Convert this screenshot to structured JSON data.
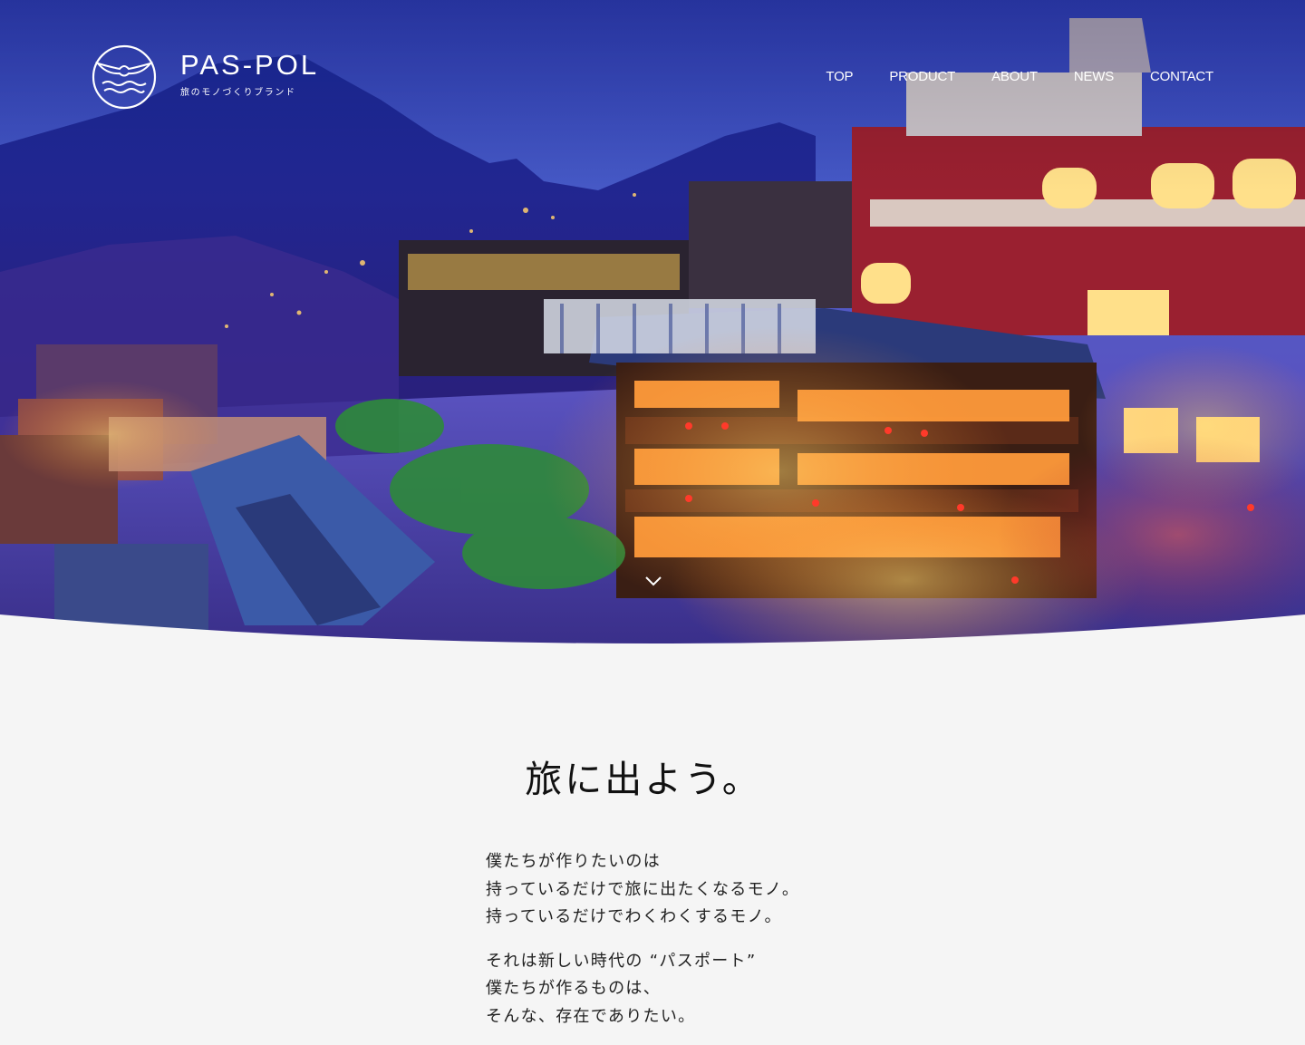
{
  "brand": {
    "name": "PAS-POL",
    "tagline": "旅のモノづくりブランド"
  },
  "nav": {
    "items": [
      "TOP",
      "PRODUCT",
      "ABOUT",
      "NEWS",
      "CONTACT"
    ]
  },
  "hero": {
    "icon": "chevron-down-icon"
  },
  "intro": {
    "headline": "旅に出よう。",
    "paragraph1": [
      "僕たちが作りたいのは",
      "持っているだけで旅に出たくなるモノ。",
      "持っているだけでわくわくするモノ。"
    ],
    "paragraph2": [
      "それは新しい時代の “パスポート”",
      "僕たちが作るものは、",
      "そんな、存在でありたい。"
    ]
  },
  "colors": {
    "page_background": "#f5f5f5",
    "text": "#111111",
    "nav_text": "#ffffff"
  }
}
